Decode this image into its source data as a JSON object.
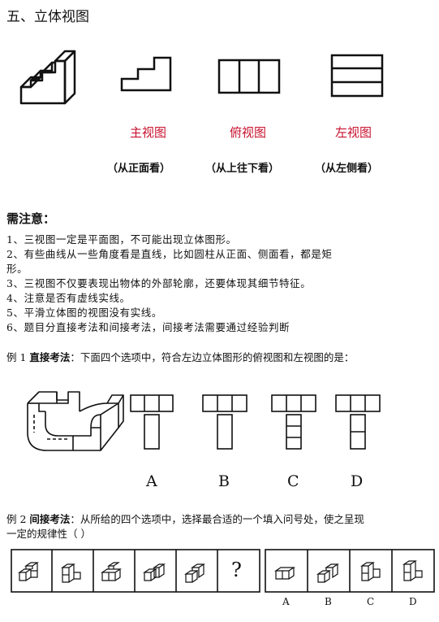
{
  "section_title": "五、立体视图",
  "views": {
    "front": "主视图",
    "top": "俯视图",
    "left": "左视图",
    "front_dir": "（从正面看）",
    "top_dir": "（从上往下看）",
    "left_dir": "（从左侧看）"
  },
  "notes": {
    "heading": "需注意：",
    "items": [
      "1、三视图一定是平面图，不可能出现立体图形。",
      "2、有些曲线从一些角度看是直线，比如圆柱从正面、侧面看，都是矩",
      "形。",
      "3、三视图不仅要表现出物体的外部轮廓，还要体现其细节特征。",
      "4、注意是否有虚线实线。",
      "5、平滑立体图的视图没有实线。",
      "6、题目分直接考法和间接考法，间接考法需要通过经验判断"
    ]
  },
  "example1": {
    "prefix": "例 1 ",
    "method": "直接考法",
    "text": "：下面四个选项中，符合左边立体图形的俯视图和左视图的是：",
    "options": [
      "A",
      "B",
      "C",
      "D"
    ]
  },
  "example2": {
    "prefix": "例 2 ",
    "method": "间接考法",
    "text1": "：从所给的四个选项中，选择最合适的一个填入问号处，使之呈现",
    "text2": "一定的规律性（    ）",
    "question_mark": "?",
    "options": [
      "A",
      "B",
      "C",
      "D"
    ]
  },
  "colors": {
    "accent": "#c8102e"
  }
}
